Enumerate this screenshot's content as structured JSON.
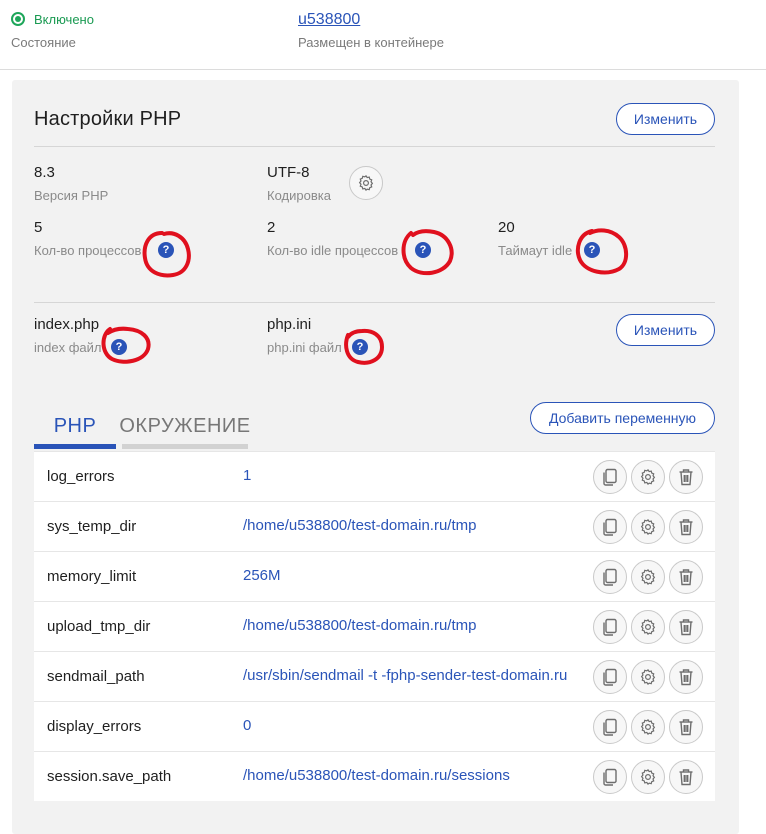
{
  "status": {
    "text": "Включено",
    "label": "Состояние",
    "color": "#1ea65a"
  },
  "container": {
    "user": "u538800",
    "label": "Размещен в контейнере"
  },
  "php_settings": {
    "title": "Настройки PHP",
    "edit_label": "Изменить",
    "version": {
      "value": "8.3",
      "label": "Версия PHP"
    },
    "encoding": {
      "value": "UTF-8",
      "label": "Кодировка"
    },
    "processes": {
      "value": "5",
      "label": "Кол-во процессов"
    },
    "idle_processes": {
      "value": "2",
      "label": "Кол-во idle процессов"
    },
    "idle_timeout": {
      "value": "20",
      "label": "Таймаут idle"
    },
    "index_file": {
      "value": "index.php",
      "label": "index файл"
    },
    "php_ini": {
      "value": "php.ini",
      "label": "php.ini файл"
    },
    "files_edit_label": "Изменить",
    "help_symbol": "?"
  },
  "tabs": [
    {
      "label": "PHP",
      "active": true
    },
    {
      "label": "ОКРУЖЕНИЕ",
      "active": false
    }
  ],
  "add_variable_label": "Добавить переменную",
  "variables": [
    {
      "name": "log_errors",
      "value": "1"
    },
    {
      "name": "sys_temp_dir",
      "value": "/home/u538800/test-domain.ru/tmp"
    },
    {
      "name": "memory_limit",
      "value": "256M"
    },
    {
      "name": "upload_tmp_dir",
      "value": "/home/u538800/test-domain.ru/tmp"
    },
    {
      "name": "sendmail_path",
      "value": "/usr/sbin/sendmail -t -fphp-sender-test-domain.ru"
    },
    {
      "name": "display_errors",
      "value": "0"
    },
    {
      "name": "session.save_path",
      "value": "/home/u538800/test-domain.ru/sessions"
    }
  ],
  "icons": {
    "status": "status-dot-icon",
    "gear": "gear-icon",
    "help": "help-icon",
    "copy": "copy-icon",
    "trash": "trash-icon"
  },
  "colors": {
    "accent": "#2a54b8",
    "annotation": "#e0101e",
    "panel_bg": "#f2f2f2"
  }
}
